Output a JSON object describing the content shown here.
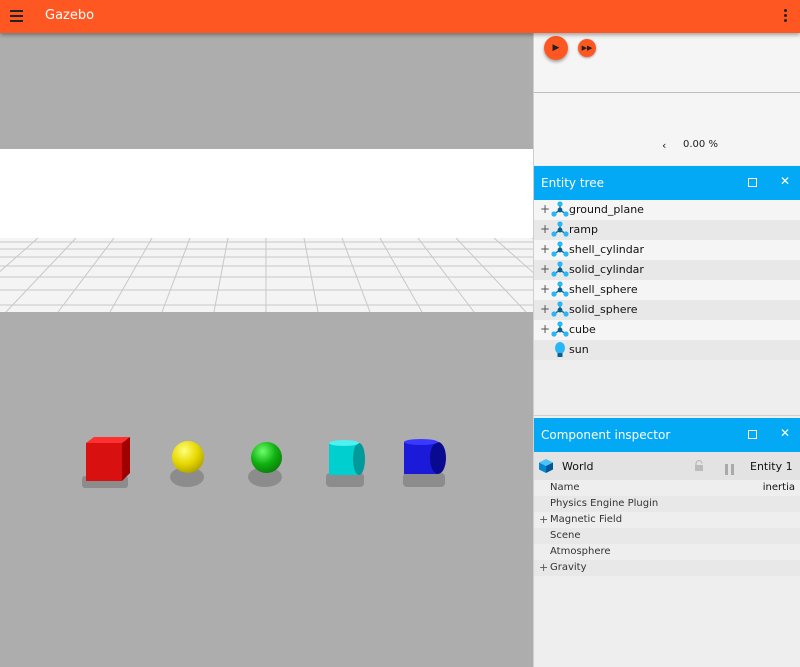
{
  "app": {
    "title": "Gazebo"
  },
  "playback": {
    "realtime_factor": "0.00 %"
  },
  "entity_tree": {
    "title": "Entity tree",
    "items": [
      {
        "label": "ground_plane",
        "icon": "model-icon"
      },
      {
        "label": "ramp",
        "icon": "model-icon"
      },
      {
        "label": "shell_cylindar",
        "icon": "model-icon"
      },
      {
        "label": "solid_cylindar",
        "icon": "model-icon"
      },
      {
        "label": "shell_sphere",
        "icon": "model-icon"
      },
      {
        "label": "solid_sphere",
        "icon": "model-icon"
      },
      {
        "label": "cube",
        "icon": "model-icon"
      },
      {
        "label": "sun",
        "icon": "light-icon"
      }
    ]
  },
  "inspector": {
    "title": "Component inspector",
    "entity_name": "World",
    "entity_id": "Entity 1",
    "rows": [
      {
        "label": "Name",
        "value": "inertia"
      },
      {
        "label": "Physics Engine Plugin",
        "value": ""
      },
      {
        "label": "Magnetic Field",
        "value": ""
      },
      {
        "label": "Scene",
        "value": ""
      },
      {
        "label": "Atmosphere",
        "value": ""
      },
      {
        "label": "Gravity",
        "value": ""
      }
    ]
  },
  "colors": {
    "accent": "#ff5722",
    "panel_header": "#03a9f4",
    "cube": "#e01010",
    "yellow_sphere": "#e6d800",
    "green_sphere": "#10b010",
    "cyan_cylinder": "#00d5d5",
    "blue_cylinder": "#1010cc"
  }
}
